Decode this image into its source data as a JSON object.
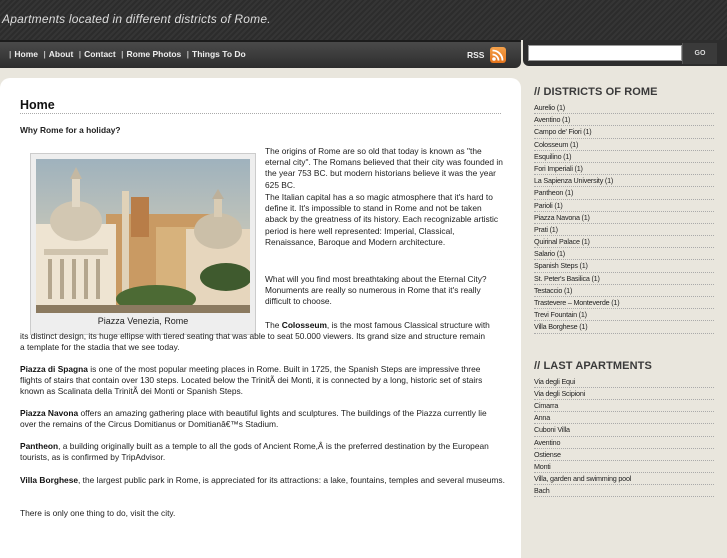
{
  "header": {
    "site_title": "Apartments located in different districts of Rome."
  },
  "nav": {
    "items": [
      "Home",
      "About",
      "Contact",
      "Rome Photos",
      "Things To Do"
    ],
    "rss_label": "RSS"
  },
  "search": {
    "placeholder": "",
    "button_label": "GO"
  },
  "content": {
    "heading": "Home",
    "subheading": "Why Rome for a holiday?",
    "photo_caption": "Piazza Venezia, Rome",
    "p1": "The origins of Rome are so old that today is known as \"the eternal city\". The Romans believed that their city was founded in the year 753 BC. but modern historians believe it was the year 625 BC.",
    "p2": "The Italian capital has a so magic atmosphere that it's hard to define it. It's impossible to stand in Rome and not be taken aback by the greatness of its history. Each recognizable artistic period is here well represented: Imperial, Classical, Renaissance, Baroque and Modern architecture.",
    "p3": "What will you find most breathtaking about the Eternal City? Monuments are really so numerous in Rome that it's really difficult to choose.",
    "colosseum": {
      "lead": "The ",
      "name": "Colosseum",
      "text": ", is the most famous Classical structure with its distinct design, its huge ellipse with tiered seating that was able to seat 50.000 viewers. Its grand size and structure remain a template for the stadia that we see today."
    },
    "spagna": {
      "name": "Piazza di Spagna",
      "text": " is one of the most popular meeting places in Rome. Built in 1725, the Spanish Steps are impressive three flights of stairs that contain over 130 steps. Located below the TrinitÃ  dei Monti, it is connected by a long, historic set of stairs known as Scalinata della TrinitÃ  dei Monti or Spanish Steps."
    },
    "navona": {
      "name": "Piazza Navona",
      "text": " offers an amazing gathering place with beautiful lights and sculptures. The buildings of the Piazza currently lie over the remains of the Circus Domitianus or Domitianâ€™s Stadium."
    },
    "pantheon": {
      "name": "Pantheon",
      "text": ", a building originally built as a temple to all the gods of Ancient Rome,Â  is the preferred destination by the European tourists, as is confirmed by TripAdvisor."
    },
    "borghese": {
      "name": "Villa Borghese",
      "text": ", the largest public park in Rome, is appreciated for its attractions: a lake, fountains, temples and several museums."
    },
    "closing": "There is only one thing to do, visit the city."
  },
  "sidebar": {
    "districts_heading": "// DISTRICTS OF ROME",
    "districts": [
      "Aurelio (1)",
      "Aventino (1)",
      "Campo de' Fiori (1)",
      "Colosseum (1)",
      "Esquilino (1)",
      "Fori Imperiali (1)",
      "La Sapienza University (1)",
      "Pantheon (1)",
      "Parioli (1)",
      "Piazza Navona (1)",
      "Prati (1)",
      "Quirinal Palace (1)",
      "Salario (1)",
      "Spanish Steps (1)",
      "St. Peter's Basilica (1)",
      "Testaccio (1)",
      "Trastevere – Monteverde (1)",
      "Trevi Fountain (1)",
      "Villa Borghese (1)"
    ],
    "apartments_heading": "// LAST APARTMENTS",
    "apartments": [
      "Via degli Equi",
      "Via degli Scipioni",
      "Cimarra",
      "Anna",
      "Cuboni Villa",
      "Aventino",
      "Ostiense",
      "Monti",
      "Villa, garden and swimming pool",
      "Bach"
    ]
  },
  "colors": {
    "accent_orange": "#e4741c",
    "header_dark": "#2c2c2c",
    "sidebar_bg": "#e9e6dd"
  },
  "icons": {
    "rss": "rss-icon",
    "photo": "photo"
  }
}
